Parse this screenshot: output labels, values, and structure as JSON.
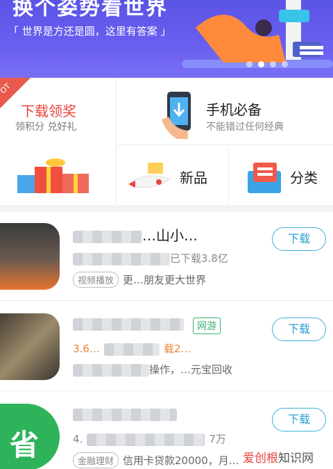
{
  "banner": {
    "title": "换个姿势看世界",
    "subtitle": "「 世界是方还是圆，这里有答案 」",
    "dots": 4,
    "active_dot": 2
  },
  "features": {
    "left": {
      "badge": "OT",
      "title": "下载领奖",
      "subtitle": "领积分 兑好礼"
    },
    "phone": {
      "title": "手机必备",
      "subtitle": "不能错过任何经典"
    },
    "new": {
      "label": "新品"
    },
    "category": {
      "label": "分类"
    }
  },
  "apps": [
    {
      "name_suffix": "…山小…",
      "meta": "已下载3.8亿",
      "tag": "视频播放",
      "desc": "更…朋友更大世界",
      "button": "下载"
    },
    {
      "badge": "网游",
      "meta_prefix": "3.6…",
      "meta_suffix": "载2…",
      "desc": "操作，…元宝回收",
      "button": "下载"
    },
    {
      "meta_prefix": "4.",
      "meta_suffix": "7万",
      "tag": "金融理财",
      "desc": "信用卡贷款20000，月…",
      "button": "下载"
    }
  ],
  "watermark": {
    "part1": "爱创根",
    "part2": "知识网"
  },
  "colors": {
    "accent": "#2b9fd3",
    "banner": "#5a54e6",
    "red": "#e8453c"
  }
}
